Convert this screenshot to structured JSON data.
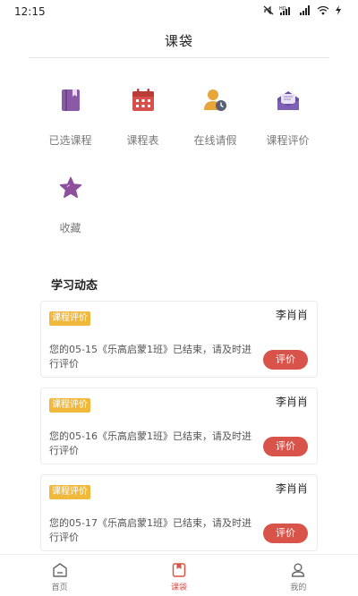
{
  "status_bar": {
    "time": "12:15",
    "icons": [
      "mute-icon",
      "hd-signal-icon",
      "signal-icon",
      "wifi-icon",
      "charging-icon"
    ],
    "network_badge": "HD"
  },
  "header": {
    "title": "课袋"
  },
  "menu": {
    "items": [
      {
        "label": "已选课程",
        "icon": "book-icon",
        "color": "#8b5aa6"
      },
      {
        "label": "课程表",
        "icon": "calendar-icon",
        "color": "#d6504c"
      },
      {
        "label": "在线请假",
        "icon": "user-clock-icon",
        "color": "#e7a53b"
      },
      {
        "label": "课程评价",
        "icon": "envelope-icon",
        "color": "#6a4ea0"
      },
      {
        "label": "收藏",
        "icon": "star-icon",
        "color": "#8e4f9c"
      }
    ]
  },
  "feed": {
    "title": "学习动态",
    "cards": [
      {
        "tag": "课程评价",
        "user": "李肖肖",
        "message": "您的05-15《乐高启蒙1班》已结束，请及时进行评价",
        "button": "评价"
      },
      {
        "tag": "课程评价",
        "user": "李肖肖",
        "message": "您的05-16《乐高启蒙1班》已结束，请及时进行评价",
        "button": "评价"
      },
      {
        "tag": "课程评价",
        "user": "李肖肖",
        "message": "您的05-17《乐高启蒙1班》已结束，请及时进行评价",
        "button": "评价"
      }
    ]
  },
  "tabbar": {
    "tabs": [
      {
        "label": "首页",
        "icon": "home-icon",
        "active": false
      },
      {
        "label": "课袋",
        "icon": "bag-icon",
        "active": true
      },
      {
        "label": "我的",
        "icon": "profile-icon",
        "active": false
      }
    ]
  },
  "colors": {
    "accent": "#d8534a",
    "tag": "#f0b93b"
  }
}
